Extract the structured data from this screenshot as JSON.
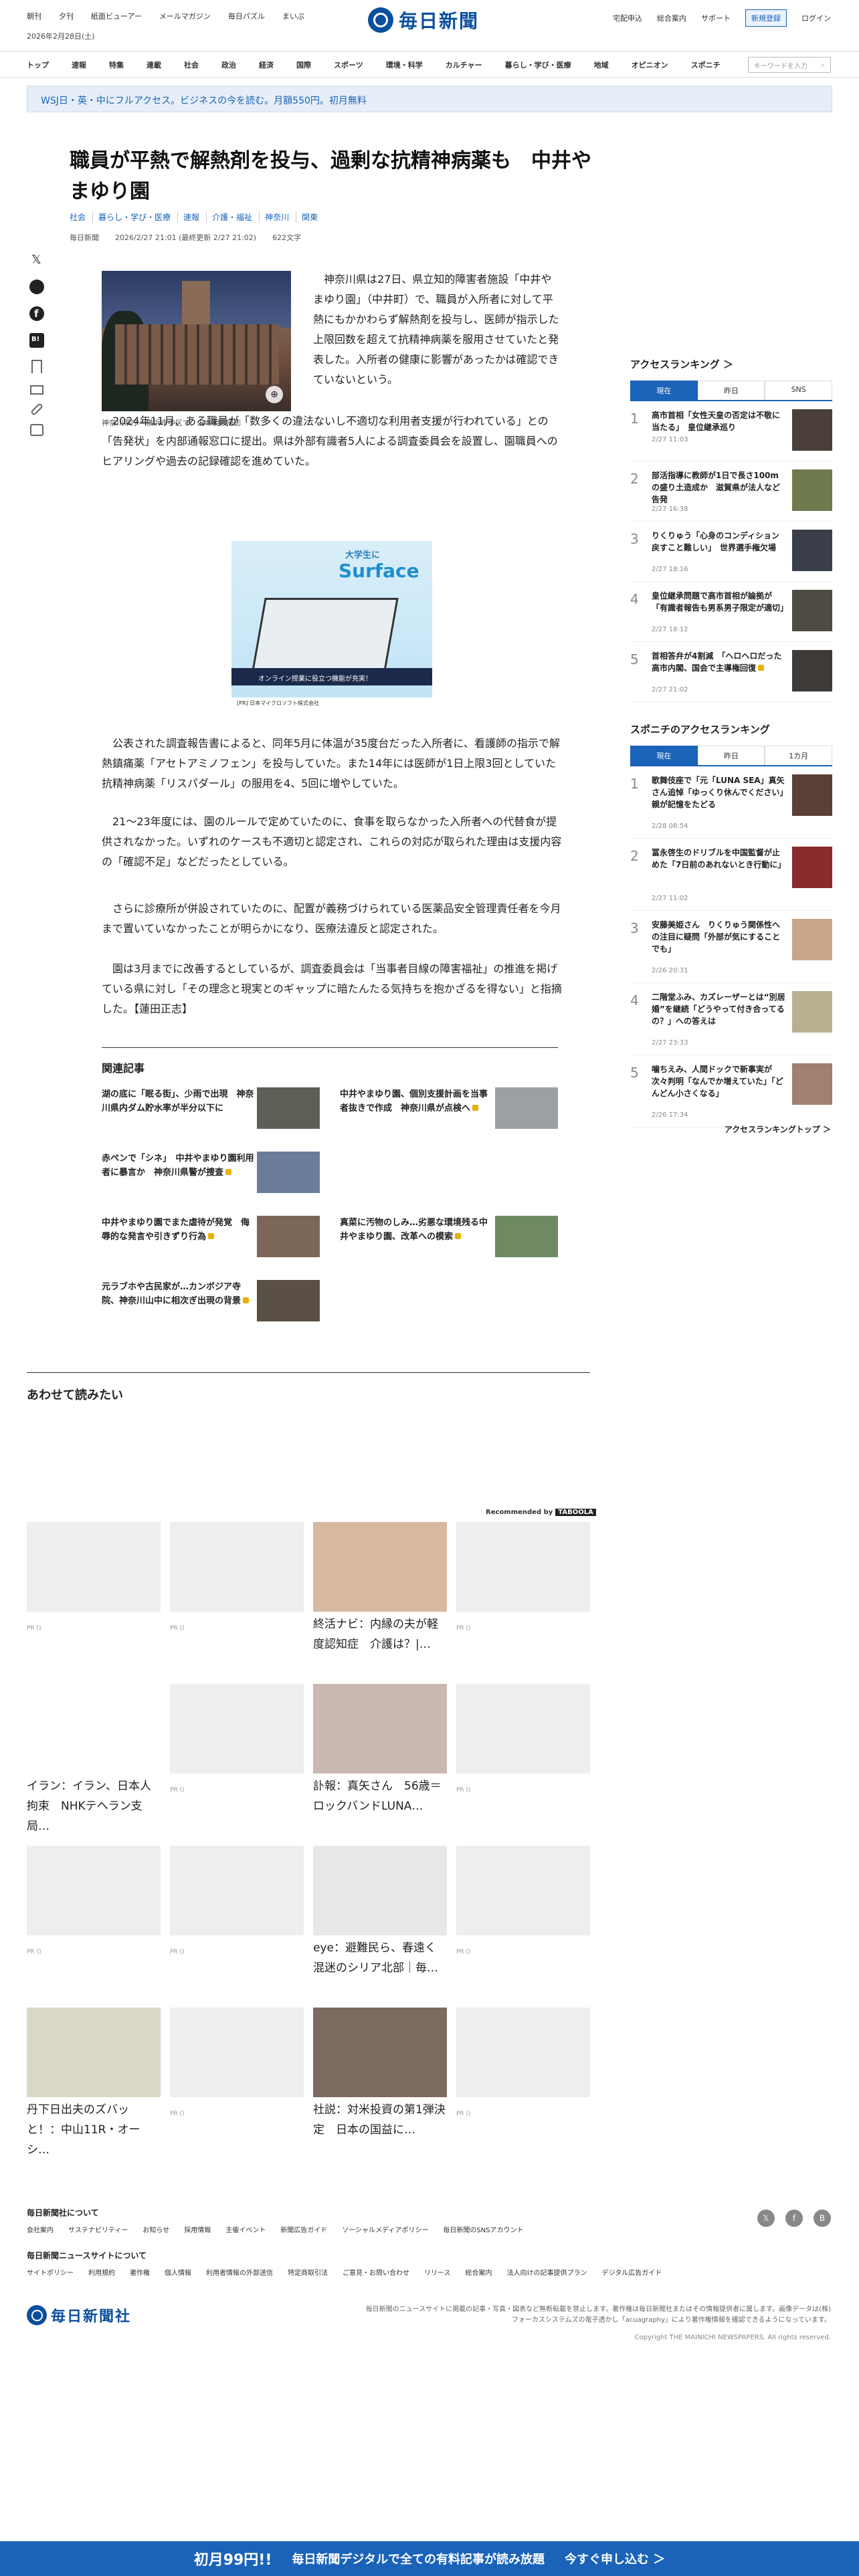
{
  "header": {
    "top_links": [
      "朝刊",
      "夕刊",
      "紙面ビューアー",
      "メールマガジン",
      "毎日パズル",
      "まいぷ"
    ],
    "date": "2026年2月28日(土)",
    "logo_text": "毎日新聞",
    "right_links": [
      "宅配申込",
      "総合案内",
      "サポート"
    ],
    "register_label": "新規登録",
    "login_label": "ログイン"
  },
  "nav": {
    "items": [
      "トップ",
      "速報",
      "特集",
      "連載",
      "社会",
      "政治",
      "経済",
      "国際",
      "スポーツ",
      "環境・科学",
      "カルチャー",
      "暮らし・学び・医療",
      "地域",
      "オピニオン",
      "スポニチ"
    ],
    "search_placeholder": "キーワードを入力"
  },
  "banner": "WSJ日・英・中にフルアクセス。ビジネスの今を読む。月額550円。初月無料",
  "article": {
    "title": "職員が平熱で解熱剤を投与、過剰な抗精神病薬も　中井やまゆり園",
    "tags": [
      "社会",
      "暮らし・学び・医療",
      "速報",
      "介護・福祉",
      "神奈川",
      "関東"
    ],
    "source": "毎日新聞",
    "datetime": "2026/2/27 21:01 (最終更新 2/27 21:02)",
    "chars": "622文字",
    "photo_caption": "神奈川県庁＝横浜市中区で、山本明彦撮影",
    "p1": "神奈川県は27日、県立知的障害者施設「中井やまゆり園」（中井町）で、職員が入所者に対して平熱にもかかわらず解熱剤を投与し、医師が指示した上限回数を超えて抗精神病薬を服用させていたと発表した。入所者の健康に影響があったかは確認できていないという。",
    "p2": "2024年11月、ある職員が「数多くの違法ないし不適切な利用者支援が行われている」との「告発状」を内部通報窓口に提出。県は外部有識者5人による調査委員会を設置し、園職員へのヒアリングや過去の記録確認を進めていた。",
    "p3": "公表された調査報告書によると、同年5月に体温が35度台だった入所者に、看護師の指示で解熱鎮痛薬「アセトアミノフェン」を投与していた。また14年には医師が1日上限3回としていた抗精神病薬「リスパダール」の服用を4、5回に増やしていた。",
    "p4": "21～23年度には、園のルールで定めていたのに、食事を取らなかった入所者への代替食が提供されなかった。いずれのケースも不適切と認定され、これらの対応が取られた理由は支援内容の「確認不足」などだったとしている。",
    "p5": "さらに診療所が併設されていたのに、配置が義務づけられている医薬品安全管理責任者を今月まで置いていなかったことが明らかになり、医療法違反と認定された。",
    "p6": "園は3月までに改善するとしているが、調査委員会は「当事者目線の障害福祉」の推進を掲げている県に対し「その理念と現実とのギャップに暗たんたる気持ちを抱かざるを得ない」と指摘した。【蓮田正志】"
  },
  "ad1": {
    "headline": "大学生に",
    "brand": "Surface",
    "bar": "オンライン授業に役立つ機能が充実！",
    "footer": "[PR] 日本マイクロソフト株式会社"
  },
  "related": {
    "heading": "関連記事",
    "items": [
      {
        "title": "湖の底に「眠る街」、少雨で出現　神奈川県内ダム貯水率が半分以下に",
        "locked": false
      },
      {
        "title": "中井やまゆり園、個別支援計画を当事者抜きで作成　神奈川県が点検へ",
        "locked": true
      },
      {
        "title": "赤ペンで「シネ」　中井やまゆり園利用者に暴言か　神奈川県警が捜査",
        "locked": true
      },
      {
        "title": "真菜に汚物のしみ…劣悪な環境残る中井やまゆり園、改革への模索",
        "locked": true
      },
      {
        "title": "中井やまゆり園でまた虐待が発覚　侮辱的な発言や引きずり行為",
        "locked": true
      },
      {
        "title": "元ラブホや古民家が…カンボジア寺院、神奈川山中に相次ぎ出現の背景",
        "locked": true
      }
    ]
  },
  "ranking": {
    "title": "アクセスランキング",
    "tabs": [
      "現在",
      "昨日",
      "SNS"
    ],
    "items": [
      {
        "num": "1",
        "text": "高市首相「女性天皇の否定は不敬に当たる」　皇位継承巡り",
        "date": "2/27 11:03"
      },
      {
        "num": "2",
        "text": "部活指導に教師が1日で長さ100mの盛り土造成か　滋賀県が法人など告発",
        "date": "2/27 16:38"
      },
      {
        "num": "3",
        "text": "りくりゅう「心身のコンディション戻すこと難しい」　世界選手権欠場",
        "date": "2/27 18:16"
      },
      {
        "num": "4",
        "text": "皇位継承問題で高市首相が論拠が「有識者報告も男系男子限定が適切」",
        "date": "2/27 18:12"
      },
      {
        "num": "5",
        "text": "首相答弁が4割減　「ヘロヘロだった高市内閣、国会で主導権回復",
        "date": "2/27 21:02"
      }
    ]
  },
  "sponichi": {
    "title": "スポニチのアクセスランキング",
    "tabs": [
      "現在",
      "昨日",
      "1カ月"
    ],
    "items": [
      {
        "num": "1",
        "text": "歌舞伎座で「元「LUNA SEA」真矢さん追悼「ゆっくり休んでください」　親が記憶をたどる",
        "date": "2/28 08:54"
      },
      {
        "num": "2",
        "text": "冨永啓生のドリブルを中国監督が止めた「7日前のあれないとき行動に」",
        "date": "2/27 11:02"
      },
      {
        "num": "3",
        "text": "安藤美姫さん　りくりゅう関係性への注目に疑問「外部が気にすることでも」",
        "date": "2/26 20:31"
      },
      {
        "num": "4",
        "text": "二階堂ふみ、カズレーザーとは“別居婚”を継続「どうやって付き合ってるの？」への答えは",
        "date": "2/27 23:33"
      },
      {
        "num": "5",
        "text": "噛ちえみ、人間ドックで新事実が次々判明「なんでか増えていた」「どんどん小さくなる」",
        "date": "2/26 17:34"
      }
    ],
    "top_link": "アクセスランキングトップ ＞"
  },
  "read_together": {
    "heading": "あわせて読みたい",
    "recommended_by": "Recommended by",
    "brand": "TABOOLA",
    "cards": [
      {
        "caption": "",
        "pr": "PR ()"
      },
      {
        "caption": "",
        "pr": "PR ()"
      },
      {
        "caption": "終活ナビ：内縁の夫が軽度認知症　介護は？|…",
        "pr": ""
      },
      {
        "caption": "",
        "pr": "PR ()"
      },
      {
        "caption": "イラン：イラン、日本人拘束　NHKテヘラン支局…",
        "pr": ""
      },
      {
        "caption": "",
        "pr": "PR ()"
      },
      {
        "caption": "訃報：真矢さん　56歳＝ロックバンドLUNA…",
        "pr": ""
      },
      {
        "caption": "",
        "pr": "PR ()"
      },
      {
        "caption": "",
        "pr": "PR ()"
      },
      {
        "caption": "",
        "pr": "PR ()"
      },
      {
        "caption": "eye：避難民ら、春遠く混迷のシリア北部｜毎…",
        "pr": ""
      },
      {
        "caption": "",
        "pr": "PR ()"
      },
      {
        "caption": "丹下日出夫のズバッと！：中山11R・オーシ…",
        "pr": ""
      },
      {
        "caption": "",
        "pr": "PR ()"
      },
      {
        "caption": "社説：対米投資の第1弾決定　日本の国益に…",
        "pr": ""
      },
      {
        "caption": "",
        "pr": "PR ()"
      }
    ]
  },
  "footer": {
    "about": "毎日新聞社について",
    "about_links": [
      "会社案内",
      "サステナビリティー",
      "お知らせ",
      "採用情報",
      "主催イベント",
      "新聞広告ガイド",
      "ソーシャルメディアポリシー",
      "毎日新聞のSNSアカウント"
    ],
    "site": "毎日新聞ニュースサイトについて",
    "site_links": [
      "サイトポリシー",
      "利用規約",
      "著作権",
      "個人情報",
      "利用者情報の外部送信",
      "特定商取引法",
      "ご意見・お問い合わせ",
      "リリース",
      "総合案内",
      "法人向けの記事提供プラン",
      "デジタル広告ガイド"
    ],
    "logo_text": "毎日新聞社",
    "note": "毎日新聞のニュースサイトに掲載の記事・写真・図表など無断転載を禁止します。著作権は毎日新聞社またはその情報提供者に属します。画像データは(株)フォーカスシステムズの電子透かし「acuagraphy」により著作権情報を確認できるようになっています。",
    "copyright": "Copyright THE MAINICHI NEWSPAPERS. All rights reserved."
  },
  "bottom_bar": {
    "left": "初月99円!!",
    "middle": "毎日新聞デジタルで全ての有料記事が読み放題",
    "right": "今すぐ申し込む ＞"
  }
}
